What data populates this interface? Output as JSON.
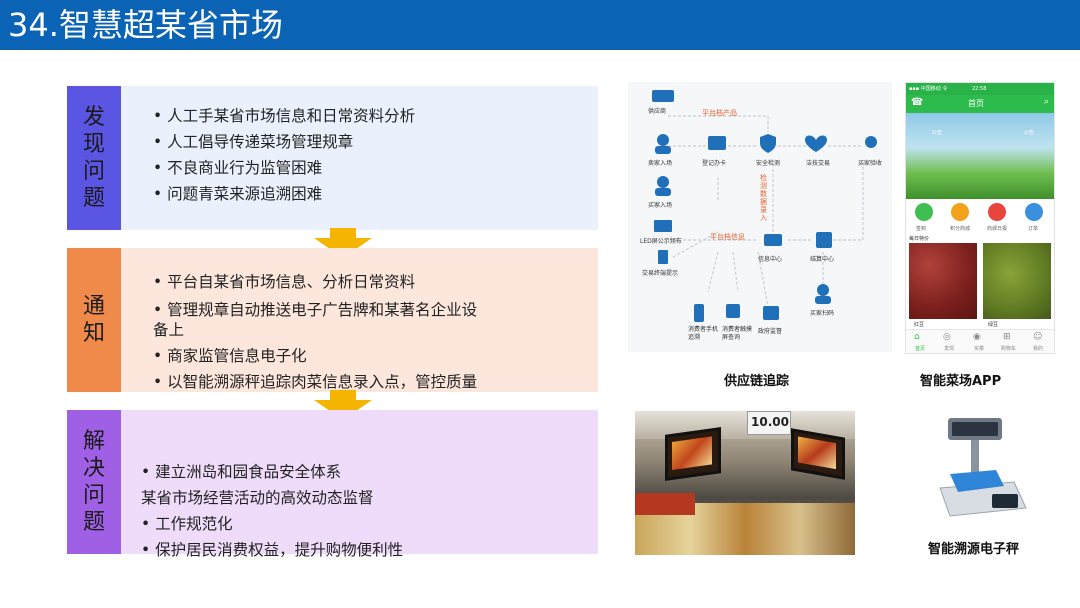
{
  "slide": {
    "title": "34.智慧超某省市场"
  },
  "sections": [
    {
      "tag": "发现问题",
      "items": [
        "• 人工手某省市场信息和日常资料分析",
        "• 人工倡导传递菜场管理规章",
        "• 不良商业行为监管困难",
        "• 问题青菜来源追溯困难"
      ]
    },
    {
      "tag": "通知",
      "items": [
        "• 平台自某省市场信息、分析日常资料",
        "• 管理规章自动推送电子广告牌和某著名企业设",
        "备上",
        "• 商家监管信息电子化",
        "• 以智能溯源秤追踪肉菜信息录入点，管控质量"
      ]
    },
    {
      "tag": "解决问题",
      "items": [
        "• 建立洲岛和园食品安全体系",
        "某省市场经营活动的高效动态监督",
        "• 工作规范化",
        "• 保护居民消费权益，提升购物便利性"
      ]
    }
  ],
  "diagram": {
    "top_label": "平台档产品",
    "mid_label": "平台档信息",
    "vert_label": "检测数据录入",
    "nodes": [
      "供应商",
      "卖家入场",
      "登记办卡",
      "安全检测",
      "洁技交易",
      "买家验收",
      "买家入场",
      "LED屏公示频布",
      "交易终端提示",
      "信息中心",
      "结算中心",
      "买家扫码",
      "消费者手机追溯",
      "消费者触摸屏查询",
      "政府监督"
    ]
  },
  "app": {
    "status_left": "▪▪▪ 中国移动 令",
    "status_time": "22:58",
    "nav_title": "首页",
    "banner_left": "公告",
    "banner_right": "公告",
    "icons": [
      "签到",
      "积分商城",
      "商城日报",
      "订单"
    ],
    "section_header": "每日特价",
    "product1": "红豆",
    "product2": "绿豆",
    "tabbar": [
      "首页",
      "发现",
      "买菜",
      "购物车",
      "我的"
    ]
  },
  "captions": {
    "supply": "供应链追踪",
    "app": "智能菜场APP",
    "scale": "智能溯源电子秤"
  },
  "supermarket": {
    "price_sign": "10.00"
  },
  "colors": {
    "title_bar": "#0a63b4",
    "section1": "#5a55e3",
    "section2": "#f08a4b",
    "section3": "#a060e6",
    "arrow": "#f5b400",
    "app_green": "#2cbb4c"
  }
}
